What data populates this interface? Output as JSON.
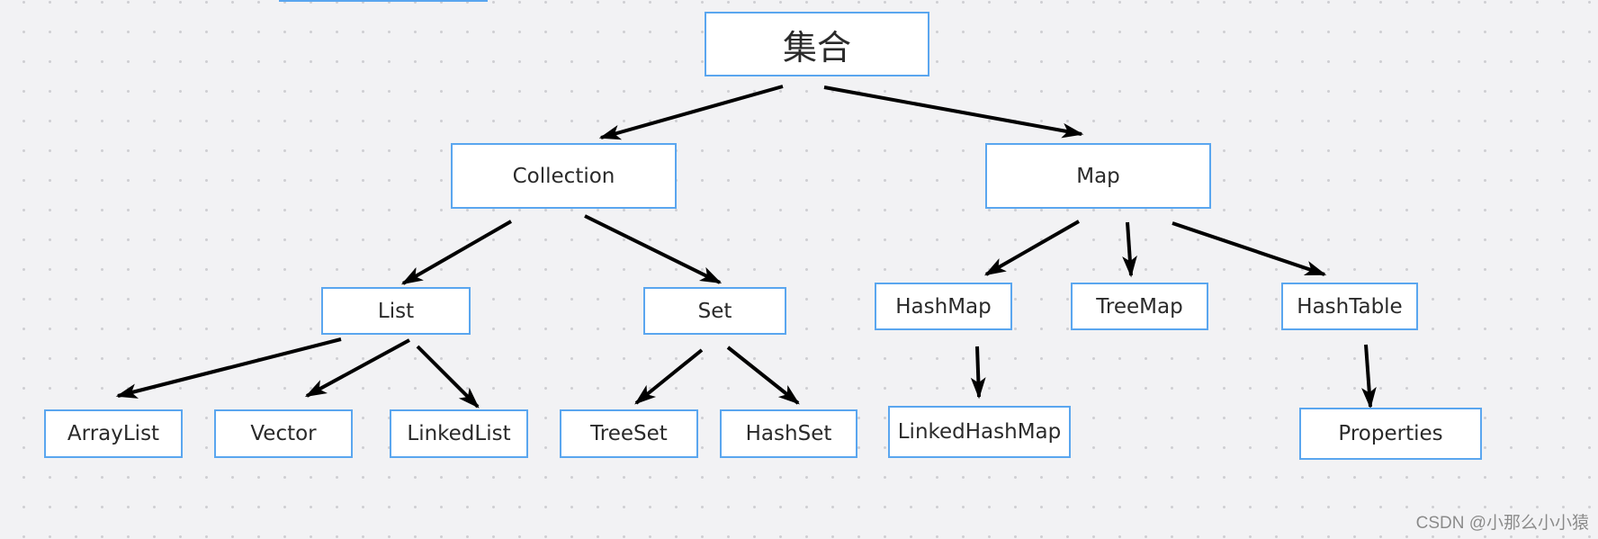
{
  "diagram": {
    "title": "集合",
    "nodes": [
      {
        "id": "root",
        "label": "集合"
      },
      {
        "id": "collection",
        "label": "Collection"
      },
      {
        "id": "map",
        "label": "Map"
      },
      {
        "id": "list",
        "label": "List"
      },
      {
        "id": "set",
        "label": "Set"
      },
      {
        "id": "hashmap",
        "label": "HashMap"
      },
      {
        "id": "treemap",
        "label": "TreeMap"
      },
      {
        "id": "hashtable",
        "label": "HashTable"
      },
      {
        "id": "arraylist",
        "label": "ArrayList"
      },
      {
        "id": "vector",
        "label": "Vector"
      },
      {
        "id": "linkedlist",
        "label": "LinkedList"
      },
      {
        "id": "treeset",
        "label": "TreeSet"
      },
      {
        "id": "hashset",
        "label": "HashSet"
      },
      {
        "id": "linkedhashmap",
        "label": "LinkedHashMap"
      },
      {
        "id": "properties",
        "label": "Properties"
      }
    ],
    "edges": [
      {
        "from": "root",
        "to": "collection"
      },
      {
        "from": "root",
        "to": "map"
      },
      {
        "from": "collection",
        "to": "list"
      },
      {
        "from": "collection",
        "to": "set"
      },
      {
        "from": "map",
        "to": "hashmap"
      },
      {
        "from": "map",
        "to": "treemap"
      },
      {
        "from": "map",
        "to": "hashtable"
      },
      {
        "from": "list",
        "to": "arraylist"
      },
      {
        "from": "list",
        "to": "vector"
      },
      {
        "from": "list",
        "to": "linkedlist"
      },
      {
        "from": "set",
        "to": "treeset"
      },
      {
        "from": "set",
        "to": "hashset"
      },
      {
        "from": "hashmap",
        "to": "linkedhashmap"
      },
      {
        "from": "hashtable",
        "to": "properties"
      }
    ]
  },
  "watermark": "CSDN @小那么小小猿"
}
